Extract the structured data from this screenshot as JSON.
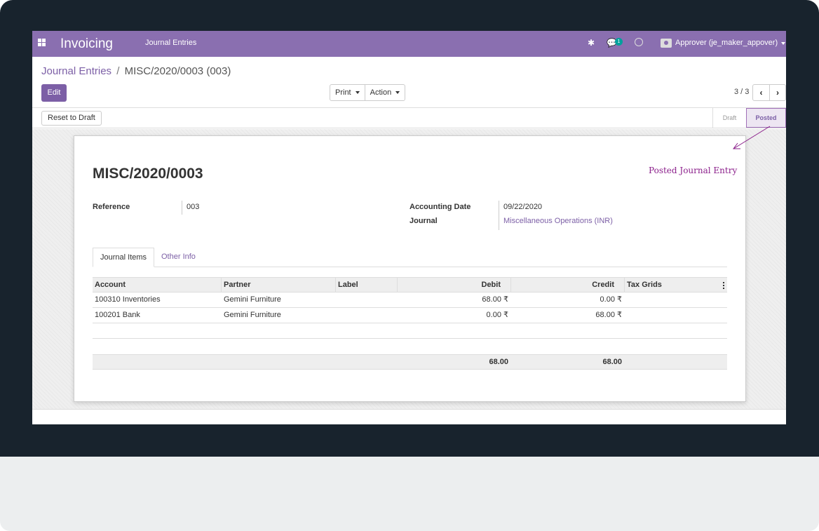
{
  "colors": {
    "brand": "#8a6fb0",
    "link": "#7c5fa6",
    "annotation": "#8b1f8b",
    "bezel": "#18232d"
  },
  "navbar": {
    "app_name": "Invoicing",
    "menu_item": "Journal Entries",
    "chat_badge": "1",
    "user": "Approver (je_maker_appover)",
    "icons": [
      "apps-grid-icon",
      "bug-icon",
      "chat-icon",
      "clock-icon",
      "camera-icon"
    ]
  },
  "breadcrumb": {
    "parent": "Journal Entries",
    "separator": "/",
    "current": "MISC/2020/0003 (003)"
  },
  "toolbar": {
    "edit": "Edit",
    "print": "Print",
    "action": "Action",
    "pager": "3 / 3"
  },
  "status": {
    "reset": "Reset to Draft",
    "draft": "Draft",
    "posted": "Posted"
  },
  "annotation": "Posted Journal Entry",
  "entry": {
    "name": "MISC/2020/0003",
    "reference_label": "Reference",
    "reference": "003",
    "accounting_date_label": "Accounting Date",
    "accounting_date": "09/22/2020",
    "journal_label": "Journal",
    "journal": "Miscellaneous Operations (INR)"
  },
  "tabs": [
    "Journal Items",
    "Other Info"
  ],
  "table": {
    "columns": [
      "Account",
      "Partner",
      "Label",
      "Debit",
      "Credit",
      "Tax Grids"
    ],
    "rows": [
      {
        "account": "100310 Inventories",
        "partner": "Gemini Furniture",
        "label": "",
        "debit": "68.00 ₹",
        "credit": "0.00 ₹",
        "tax": ""
      },
      {
        "account": "100201 Bank",
        "partner": "Gemini Furniture",
        "label": "",
        "debit": "0.00 ₹",
        "credit": "68.00 ₹",
        "tax": ""
      }
    ],
    "totals": {
      "debit": "68.00",
      "credit": "68.00"
    }
  }
}
